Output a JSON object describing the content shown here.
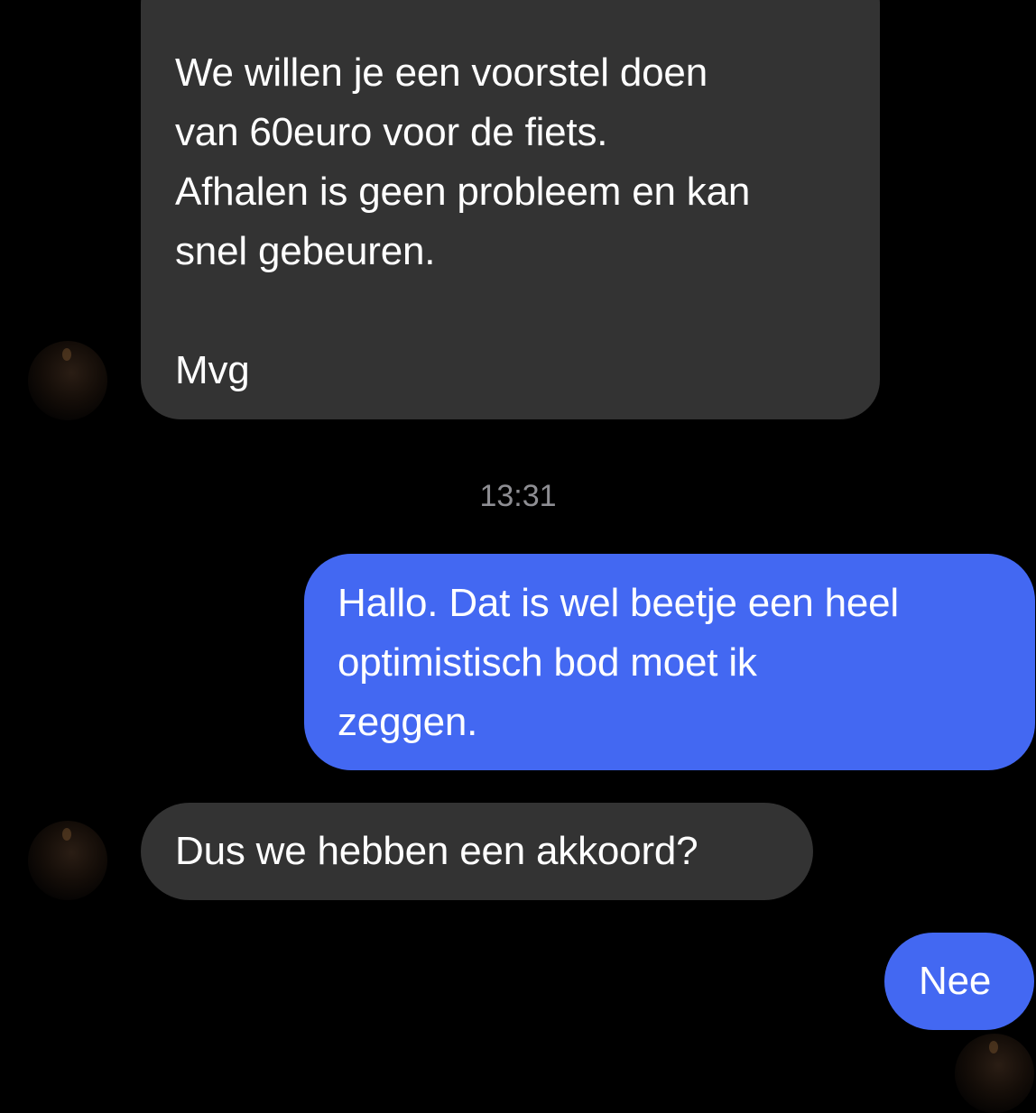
{
  "messages": [
    {
      "sender": "other",
      "lines": [
        "We willen je een voorstel doen",
        "van 60euro voor de fiets.",
        "Afhalen is geen probleem en kan",
        "snel gebeuren.",
        "",
        "Mvg"
      ]
    },
    {
      "sender": "me",
      "lines": [
        "Hallo. Dat is wel beetje een heel",
        "optimistisch bod moet ik",
        "zeggen."
      ]
    },
    {
      "sender": "other",
      "lines": [
        "Dus we hebben een akkoord?"
      ]
    },
    {
      "sender": "me",
      "lines": [
        "Nee"
      ]
    }
  ],
  "timestamp": "13:31",
  "colors": {
    "background": "#000000",
    "incoming_bubble": "#333333",
    "outgoing_bubble": "#4368f2",
    "text": "#ffffff",
    "timestamp": "#8e8e93"
  },
  "icons": {
    "avatar": "contact-avatar-photo"
  }
}
